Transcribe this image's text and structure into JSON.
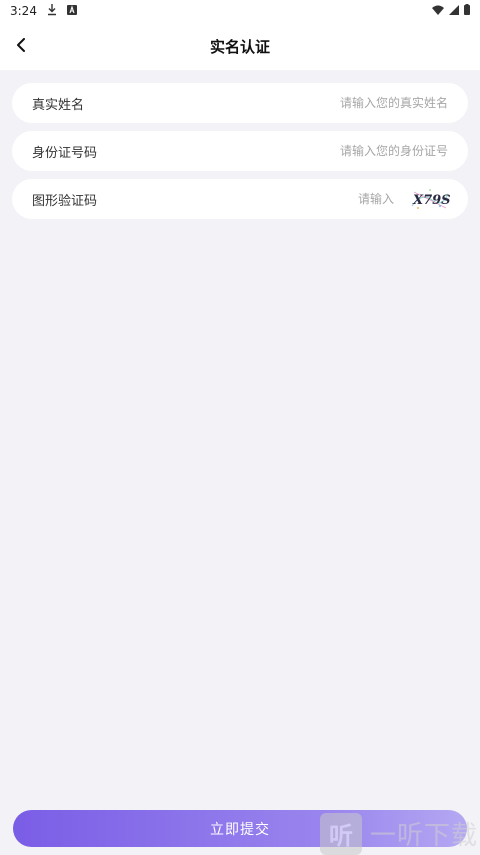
{
  "status_bar": {
    "time": "3:24",
    "left_icons": [
      "download-icon",
      "font-icon"
    ],
    "right_icons": [
      "wifi-icon",
      "signal-icon",
      "battery-icon"
    ]
  },
  "nav": {
    "title": "实名认证",
    "back_icon": "chevron-left-icon"
  },
  "form": {
    "name": {
      "label": "真实姓名",
      "placeholder": "请输入您的真实姓名",
      "value": ""
    },
    "id_number": {
      "label": "身份证号码",
      "placeholder": "请输入您的身份证号",
      "value": ""
    },
    "captcha": {
      "label": "图形验证码",
      "placeholder": "请输入",
      "value": "",
      "image_text": "X79S"
    }
  },
  "submit": {
    "label": "立即提交"
  },
  "watermark": {
    "text": "一听下载",
    "logo_char": "听"
  },
  "colors": {
    "background": "#f3f2f7",
    "accent_start": "#7a5de6",
    "accent_end": "#b5a8f2",
    "placeholder": "#a6a6a6"
  }
}
